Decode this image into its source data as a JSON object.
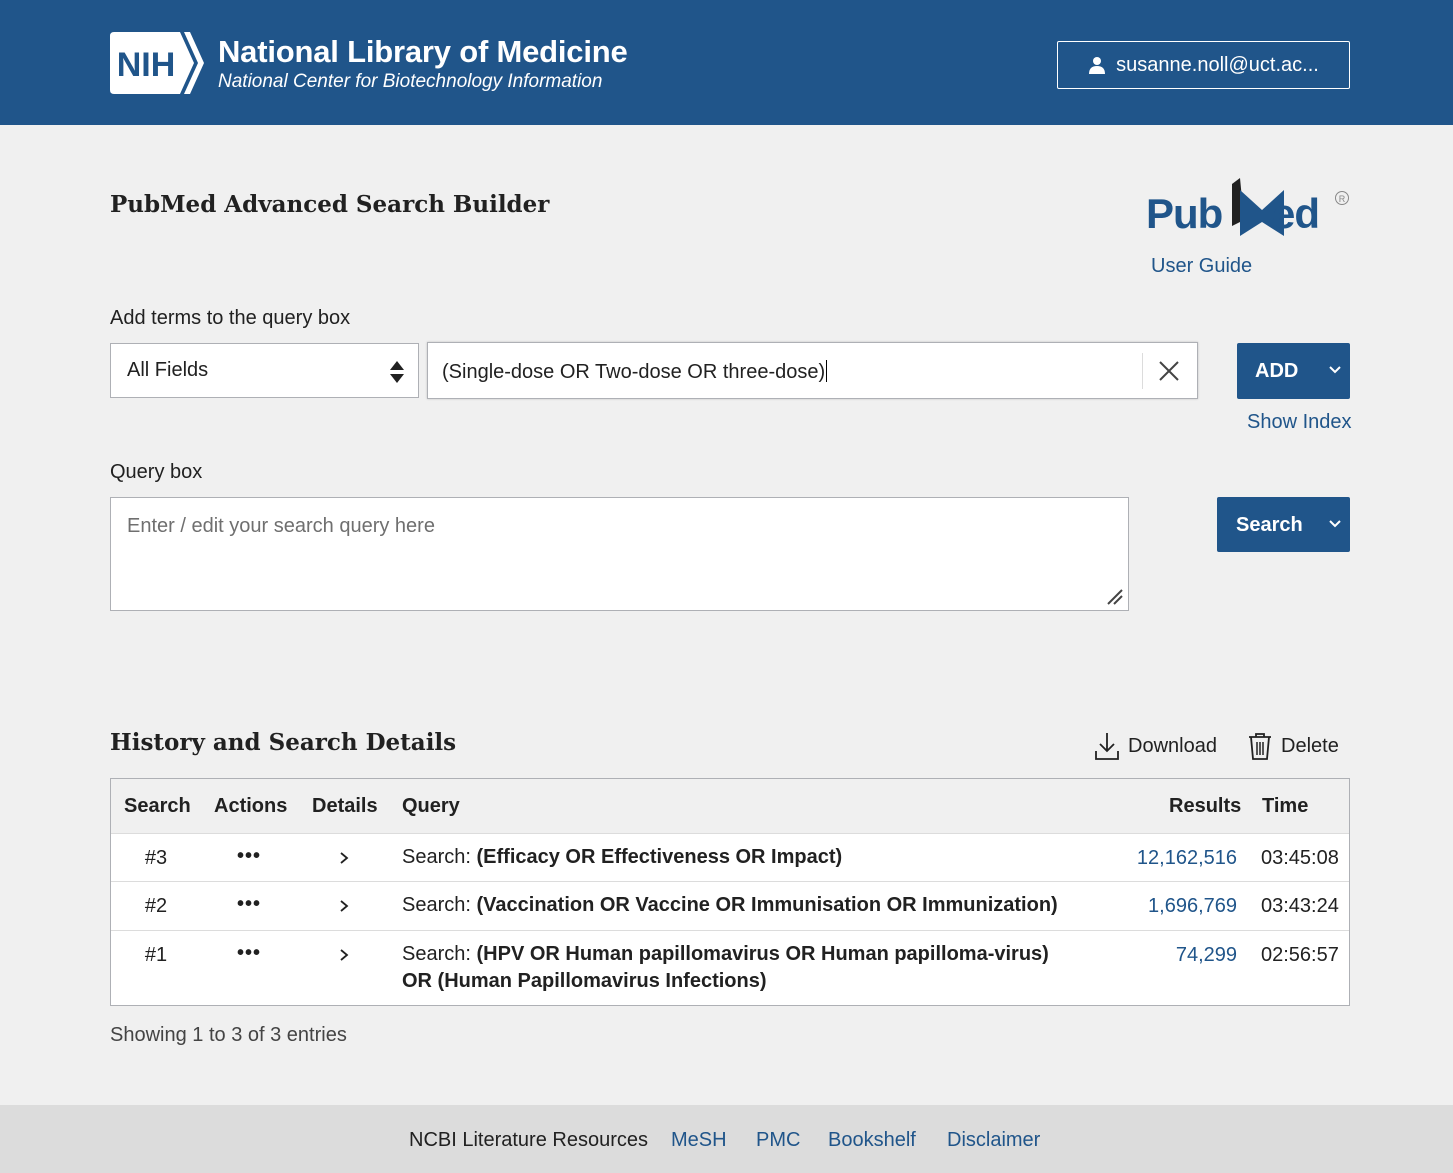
{
  "header": {
    "logo_text": "NIH",
    "title": "National Library of Medicine",
    "subtitle": "National Center for Biotechnology Information",
    "account": "susanne.noll@uct.ac..."
  },
  "page": {
    "title": "PubMed Advanced Search Builder",
    "logo_text": "PubMed",
    "user_guide": "User Guide"
  },
  "builder": {
    "add_terms_label": "Add terms to the query box",
    "field_select_value": "All Fields",
    "term_value": "(Single-dose OR Two-dose OR three-dose)",
    "add_button": "ADD",
    "show_index": "Show Index",
    "query_box_label": "Query box",
    "query_placeholder": "Enter / edit your search query here",
    "search_button": "Search"
  },
  "history": {
    "title": "History and Search Details",
    "download": "Download",
    "delete": "Delete",
    "columns": [
      "Search",
      "Actions",
      "Details",
      "Query",
      "Results",
      "Time"
    ],
    "rows": [
      {
        "num": "#3",
        "actions": "•••",
        "query_prefix": "Search:",
        "query": "(Efficacy OR Effectiveness OR Impact)",
        "query_line2": "",
        "results": "12,162,516",
        "time": "03:45:08"
      },
      {
        "num": "#2",
        "actions": "•••",
        "query_prefix": "Search:",
        "query": "(Vaccination OR Vaccine OR Immunisation OR Immunization)",
        "query_line2": "",
        "results": "1,696,769",
        "time": "03:43:24"
      },
      {
        "num": "#1",
        "actions": "•••",
        "query_prefix": "Search:",
        "query": "(HPV OR Human papillomavirus OR Human papilloma-virus)",
        "query_line2": "OR (Human Papillomavirus Infections)",
        "results": "74,299",
        "time": "02:56:57"
      }
    ],
    "showing": "Showing 1 to 3 of 3 entries"
  },
  "footer": {
    "items": [
      "NCBI Literature Resources",
      "MeSH",
      "PMC",
      "Bookshelf",
      "Disclaimer"
    ]
  },
  "colors": {
    "brand_blue": "#20558a",
    "background": "#f0f0f0",
    "footer_bg": "#dcdcdc"
  }
}
